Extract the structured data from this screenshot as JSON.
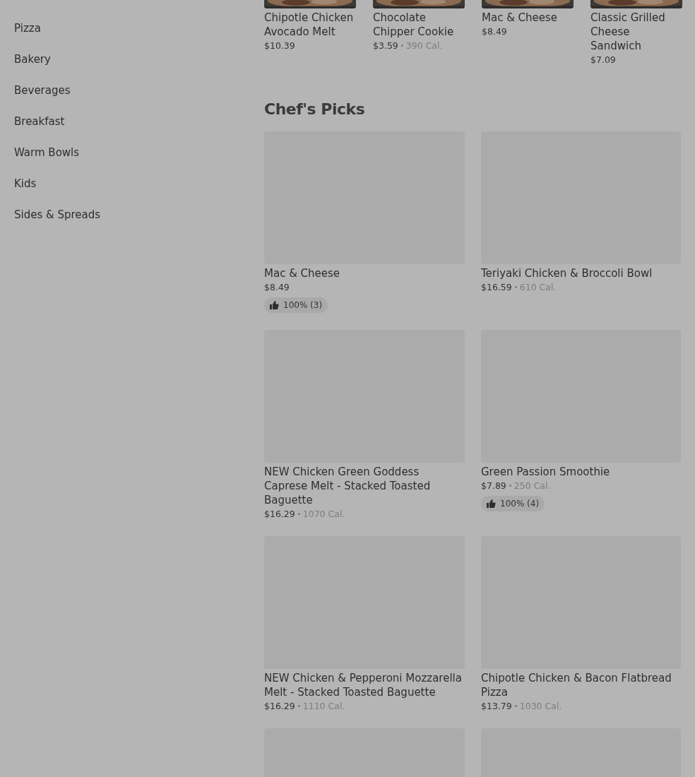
{
  "sidebar": {
    "items": [
      {
        "label": "Pizza"
      },
      {
        "label": "Bakery"
      },
      {
        "label": "Beverages"
      },
      {
        "label": "Breakfast"
      },
      {
        "label": "Warm Bowls"
      },
      {
        "label": "Kids"
      },
      {
        "label": "Sides & Spreads"
      }
    ]
  },
  "top_row": [
    {
      "kind": "picture",
      "name": "Chipotle Chicken Avocado Melt",
      "price": "$10.39"
    },
    {
      "kind": "picture",
      "name": "Chocolate Chipper Cookie",
      "price": "$3.59",
      "calories": "390 Cal."
    },
    {
      "kind": "picture",
      "name": "Mac & Cheese",
      "price": "$8.49"
    },
    {
      "kind": "picture",
      "name": "Classic Grilled Cheese Sandwich",
      "price": "$7.09"
    }
  ],
  "chefs_picks": {
    "title": "Chef's Picks",
    "items": [
      {
        "kind": "placeholder",
        "name": "Mac & Cheese",
        "price": "$8.49",
        "rating": "100% (3)"
      },
      {
        "kind": "placeholder",
        "name": "Teriyaki Chicken & Broccoli Bowl",
        "price": "$16.59",
        "calories": "610 Cal."
      },
      {
        "kind": "placeholder",
        "name": "NEW Chicken Green Goddess Caprese Melt - Stacked Toasted Baguette",
        "price": "$16.29",
        "calories": "1070 Cal."
      },
      {
        "kind": "placeholder",
        "name": "Green Passion Smoothie",
        "price": "$7.89",
        "calories": "250 Cal.",
        "rating": "100% (4)"
      },
      {
        "kind": "placeholder",
        "name": "NEW Chicken & Pepperoni Mozzarella Melt - Stacked Toasted Baguette",
        "price": "$16.29",
        "calories": "1110 Cal."
      },
      {
        "kind": "placeholder",
        "name": "Chipotle Chicken & Bacon Flatbread Pizza",
        "price": "$13.79",
        "calories": "1030 Cal."
      },
      {
        "kind": "placeholder"
      },
      {
        "kind": "placeholder"
      }
    ]
  }
}
